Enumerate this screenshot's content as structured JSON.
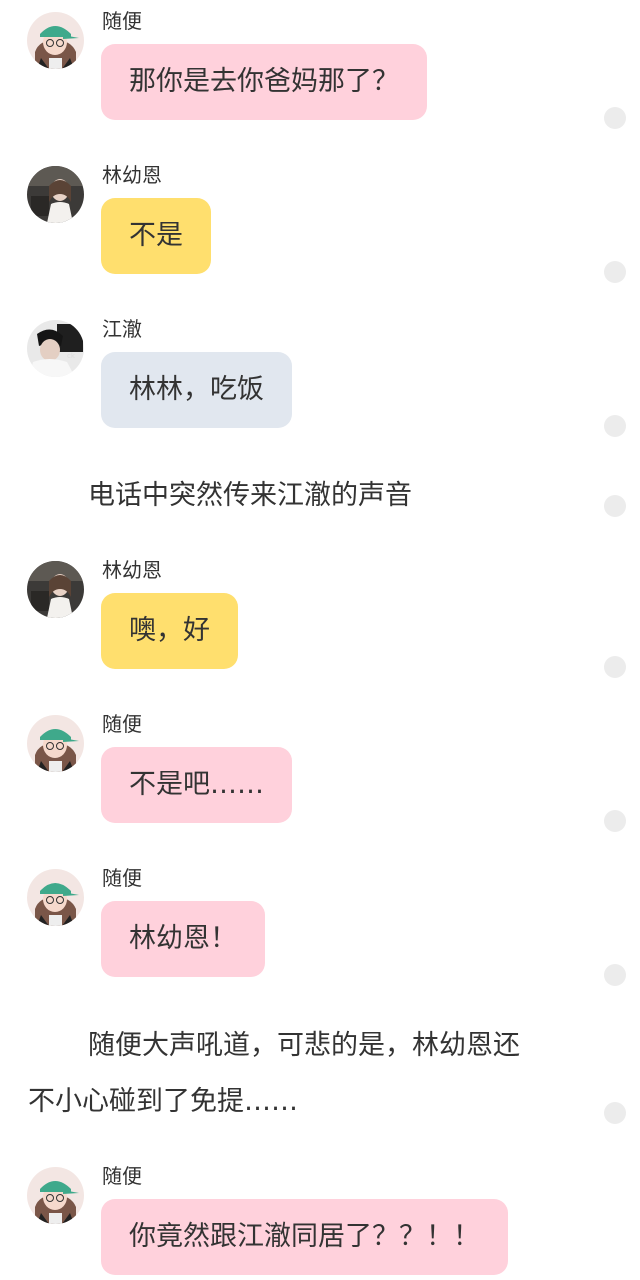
{
  "messages": [
    {
      "speaker": "随便",
      "text": "那你是去你爸妈那了？"
    },
    {
      "speaker": "林幼恩",
      "text": "不是"
    },
    {
      "speaker": "江澈",
      "text": "林林，吃饭"
    },
    {
      "narration": "电话中突然传来江澈的声音"
    },
    {
      "speaker": "林幼恩",
      "text": "噢，好"
    },
    {
      "speaker": "随便",
      "text": "不是吧……"
    },
    {
      "speaker": "随便",
      "text": "林幼恩！"
    },
    {
      "narration_line1": "随便大声吼道，可悲的是，林幼恩还",
      "narration_line2": "不小心碰到了免提……"
    },
    {
      "speaker": "随便",
      "text": "你竟然跟江澈同居了？？！！"
    }
  ],
  "colors": {
    "suibian_bubble": "#ffd1dc",
    "linyouen_bubble": "#ffdf6e",
    "jiangche_bubble": "#e1e7ef",
    "text": "#333333"
  },
  "icons": {
    "suibian": "girl-green-cap-avatar-icon",
    "linyouen": "girl-dark-photo-avatar-icon",
    "jiangche": "boy-dark-photo-avatar-icon",
    "side_dot": "comment-dot-icon"
  }
}
